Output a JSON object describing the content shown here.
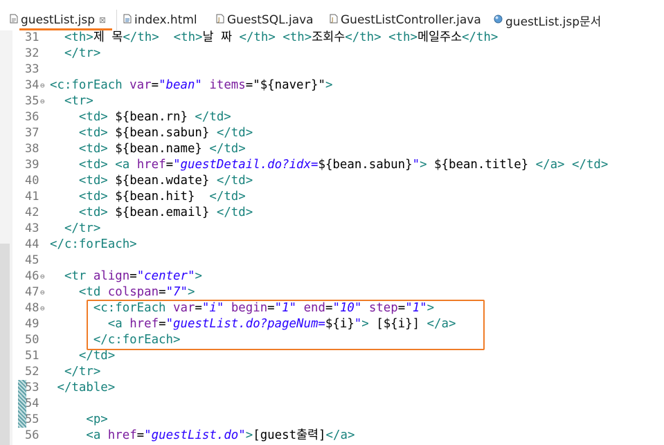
{
  "tabs": [
    {
      "label": "guestList.jsp",
      "icon": "jsp-file-icon",
      "active": true,
      "closable": true
    },
    {
      "label": "index.html",
      "icon": "html-file-icon"
    },
    {
      "label": "GuestSQL.java",
      "icon": "java-file-icon"
    },
    {
      "label": "GuestListController.java",
      "icon": "java-file-icon"
    },
    {
      "label": "guestList.jsp문서",
      "icon": "web-browser-icon"
    }
  ],
  "close_glyph": "⊠",
  "accent_color": "#f47a20",
  "lines": [
    {
      "num": "31",
      "code": [
        [
          "t",
          "<th>"
        ],
        [
          "p",
          "제 목"
        ],
        [
          "t",
          "</th>"
        ],
        [
          "p",
          "  "
        ],
        [
          "t",
          "<th>"
        ],
        [
          "p",
          "날 짜 "
        ],
        [
          "t",
          "</th>"
        ],
        [
          "p",
          " "
        ],
        [
          "t",
          "<th>"
        ],
        [
          "p",
          "조회수"
        ],
        [
          "t",
          "</th>"
        ],
        [
          "p",
          " "
        ],
        [
          "t",
          "<th>"
        ],
        [
          "p",
          "메일주소"
        ],
        [
          "t",
          "</th>"
        ]
      ],
      "indent": "  "
    },
    {
      "num": "32",
      "code": [
        [
          "t",
          "</tr>"
        ]
      ],
      "indent": "  "
    },
    {
      "num": "33",
      "code": [],
      "indent": ""
    },
    {
      "num": "34",
      "fold": true,
      "code": [
        [
          "t",
          "<c:forEach "
        ],
        [
          "a",
          "var"
        ],
        [
          "p",
          "="
        ],
        [
          "s",
          "\"bean\""
        ],
        [
          "p",
          " "
        ],
        [
          "a",
          "items"
        ],
        [
          "p",
          "="
        ],
        [
          "k",
          "\"${naver}\""
        ],
        [
          "t",
          ">"
        ]
      ],
      "indent": ""
    },
    {
      "num": "35",
      "fold": true,
      "code": [
        [
          "t",
          "<tr>"
        ]
      ],
      "indent": "  "
    },
    {
      "num": "36",
      "code": [
        [
          "t",
          "<td>"
        ],
        [
          "k",
          " ${bean.rn} "
        ],
        [
          "t",
          "</td>"
        ]
      ],
      "indent": "    "
    },
    {
      "num": "37",
      "code": [
        [
          "t",
          "<td>"
        ],
        [
          "k",
          " ${bean.sabun} "
        ],
        [
          "t",
          "</td>"
        ]
      ],
      "indent": "    "
    },
    {
      "num": "38",
      "code": [
        [
          "t",
          "<td>"
        ],
        [
          "k",
          " ${bean.name} "
        ],
        [
          "t",
          "</td>"
        ]
      ],
      "indent": "    "
    },
    {
      "num": "39",
      "code": [
        [
          "t",
          "<td>"
        ],
        [
          "p",
          " "
        ],
        [
          "t",
          "<a "
        ],
        [
          "a",
          "href"
        ],
        [
          "p",
          "="
        ],
        [
          "s",
          "\"guestDetail.do?idx="
        ],
        [
          "k",
          "${bean.sabun}"
        ],
        [
          "s",
          "\""
        ],
        [
          "t",
          ">"
        ],
        [
          "k",
          " ${bean.title} "
        ],
        [
          "t",
          "</a>"
        ],
        [
          "p",
          " "
        ],
        [
          "t",
          "</td>"
        ]
      ],
      "indent": "    "
    },
    {
      "num": "40",
      "code": [
        [
          "t",
          "<td>"
        ],
        [
          "k",
          " ${bean.wdate} "
        ],
        [
          "t",
          "</td>"
        ]
      ],
      "indent": "    "
    },
    {
      "num": "41",
      "code": [
        [
          "t",
          "<td>"
        ],
        [
          "k",
          " ${bean.hit}  "
        ],
        [
          "t",
          "</td>"
        ]
      ],
      "indent": "    "
    },
    {
      "num": "42",
      "code": [
        [
          "t",
          "<td>"
        ],
        [
          "k",
          " ${bean.email} "
        ],
        [
          "t",
          "</td>"
        ]
      ],
      "indent": "    "
    },
    {
      "num": "43",
      "code": [
        [
          "t",
          "</tr>"
        ]
      ],
      "indent": "  "
    },
    {
      "num": "44",
      "code": [
        [
          "t",
          "</c:forEach>"
        ]
      ],
      "indent": ""
    },
    {
      "num": "45",
      "code": [],
      "indent": ""
    },
    {
      "num": "46",
      "fold": true,
      "code": [
        [
          "t",
          "<tr "
        ],
        [
          "a",
          "align"
        ],
        [
          "p",
          "="
        ],
        [
          "s",
          "\"center\""
        ],
        [
          "t",
          ">"
        ]
      ],
      "indent": "  "
    },
    {
      "num": "47",
      "fold": true,
      "code": [
        [
          "t",
          "<td "
        ],
        [
          "a",
          "colspan"
        ],
        [
          "p",
          "="
        ],
        [
          "s",
          "\"7\""
        ],
        [
          "t",
          ">"
        ]
      ],
      "indent": "    "
    },
    {
      "num": "48",
      "fold": true,
      "code": [
        [
          "t",
          "<c:forEach "
        ],
        [
          "a",
          "var"
        ],
        [
          "p",
          "="
        ],
        [
          "s",
          "\"i\""
        ],
        [
          "p",
          " "
        ],
        [
          "a",
          "begin"
        ],
        [
          "p",
          "="
        ],
        [
          "s",
          "\"1\""
        ],
        [
          "p",
          " "
        ],
        [
          "a",
          "end"
        ],
        [
          "p",
          "="
        ],
        [
          "s",
          "\"10\""
        ],
        [
          "p",
          " "
        ],
        [
          "a",
          "step"
        ],
        [
          "p",
          "="
        ],
        [
          "s",
          "\"1\""
        ],
        [
          "t",
          ">"
        ]
      ],
      "indent": "      "
    },
    {
      "num": "49",
      "code": [
        [
          "t",
          "<a "
        ],
        [
          "a",
          "href"
        ],
        [
          "p",
          "="
        ],
        [
          "s",
          "\"guestList.do?pageNum="
        ],
        [
          "k",
          "${i}"
        ],
        [
          "s",
          "\""
        ],
        [
          "t",
          ">"
        ],
        [
          "k",
          " [${i}] "
        ],
        [
          "t",
          "</a>"
        ]
      ],
      "indent": "        "
    },
    {
      "num": "50",
      "code": [
        [
          "t",
          "</c:forEach>"
        ]
      ],
      "indent": "      "
    },
    {
      "num": "51",
      "code": [
        [
          "t",
          "</td>"
        ]
      ],
      "indent": "    "
    },
    {
      "num": "52",
      "code": [
        [
          "t",
          "</tr>"
        ]
      ],
      "indent": "  "
    },
    {
      "num": "53",
      "marker": true,
      "code": [
        [
          "t",
          "</table>"
        ]
      ],
      "indent": " "
    },
    {
      "num": "54",
      "marker": true,
      "code": [],
      "indent": ""
    },
    {
      "num": "55",
      "marker": true,
      "code": [
        [
          "t",
          "<p>"
        ]
      ],
      "indent": "     "
    },
    {
      "num": "56",
      "code": [
        [
          "t",
          "<a "
        ],
        [
          "a",
          "href"
        ],
        [
          "p",
          "="
        ],
        [
          "s",
          "\"guestList.do\""
        ],
        [
          "t",
          ">"
        ],
        [
          "k",
          "[guest출력]"
        ],
        [
          "t",
          "</a>"
        ]
      ],
      "indent": "     "
    }
  ]
}
